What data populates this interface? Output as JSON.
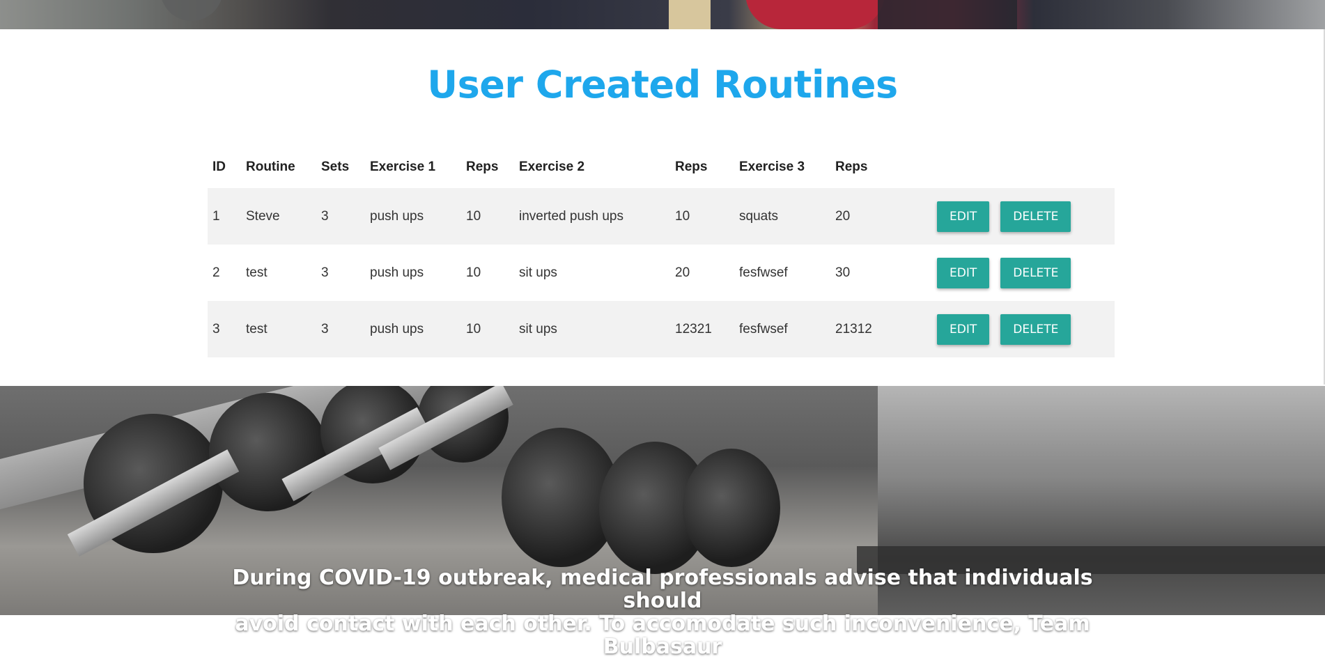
{
  "section_title": "User Created Routines",
  "table": {
    "headers": {
      "id": "ID",
      "routine": "Routine",
      "sets": "Sets",
      "exercise1": "Exercise 1",
      "reps1": "Reps",
      "exercise2": "Exercise 2",
      "reps2": "Reps",
      "exercise3": "Exercise 3",
      "reps3": "Reps"
    },
    "rows": [
      {
        "id": "1",
        "routine": "Steve",
        "sets": "3",
        "exercise1": "push ups",
        "reps1": "10",
        "exercise2": "inverted push ups",
        "reps2": "10",
        "exercise3": "squats",
        "reps3": "20"
      },
      {
        "id": "2",
        "routine": "test",
        "sets": "3",
        "exercise1": "push ups",
        "reps1": "10",
        "exercise2": "sit ups",
        "reps2": "20",
        "exercise3": "fesfwsef",
        "reps3": "30"
      },
      {
        "id": "3",
        "routine": "test",
        "sets": "3",
        "exercise1": "push ups",
        "reps1": "10",
        "exercise2": "sit ups",
        "reps2": "12321",
        "exercise3": "fesfwsef",
        "reps3": "21312"
      }
    ],
    "edit_label": "EDIT",
    "delete_label": "DELETE"
  },
  "covid_notice": {
    "line1": "During COVID-19 outbreak, medical professionals advise that individuals should",
    "line2": "avoid contact with each other. To accomodate such inconvenience, Team Bulbasaur"
  },
  "colors": {
    "title": "#1ea7ec",
    "button": "#26a69a",
    "row_stripe": "#f2f2f2"
  }
}
